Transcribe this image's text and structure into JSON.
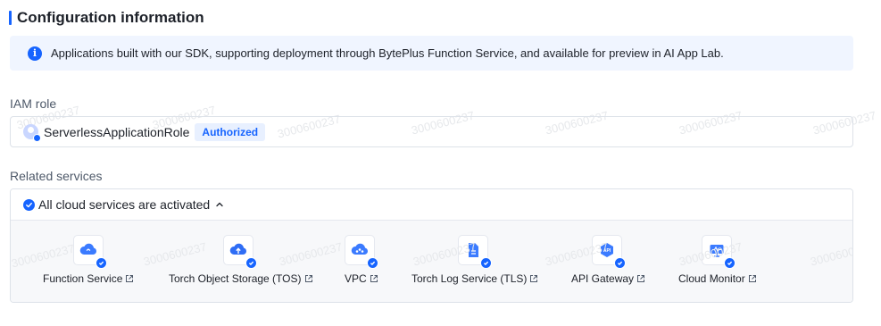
{
  "watermark_text": "3000600237",
  "section": {
    "title": "Configuration information"
  },
  "info_banner": {
    "text": "Applications built with our SDK, supporting deployment through BytePlus Function Service, and available for preview in AI App Lab.",
    "icon": "info-icon"
  },
  "iam_role": {
    "label": "IAM role",
    "role_name": "ServerlessApplicationRole",
    "status": "Authorized"
  },
  "related_services": {
    "label": "Related services",
    "header": "All cloud services are activated",
    "items": [
      {
        "name": "Function Service",
        "icon": "cloud-function-icon"
      },
      {
        "name": "Torch Object Storage (TOS)",
        "icon": "cloud-upload-icon"
      },
      {
        "name": "VPC",
        "icon": "vpc-icon"
      },
      {
        "name": "Torch Log Service (TLS)",
        "icon": "log-document-icon"
      },
      {
        "name": "API Gateway",
        "icon": "api-gateway-icon"
      },
      {
        "name": "Cloud Monitor",
        "icon": "monitor-icon"
      }
    ]
  },
  "colors": {
    "accent": "#1664ff",
    "banner_bg": "#f0f5ff",
    "badge_bg": "#e8f0ff",
    "services_bg": "#f7f8fa"
  }
}
